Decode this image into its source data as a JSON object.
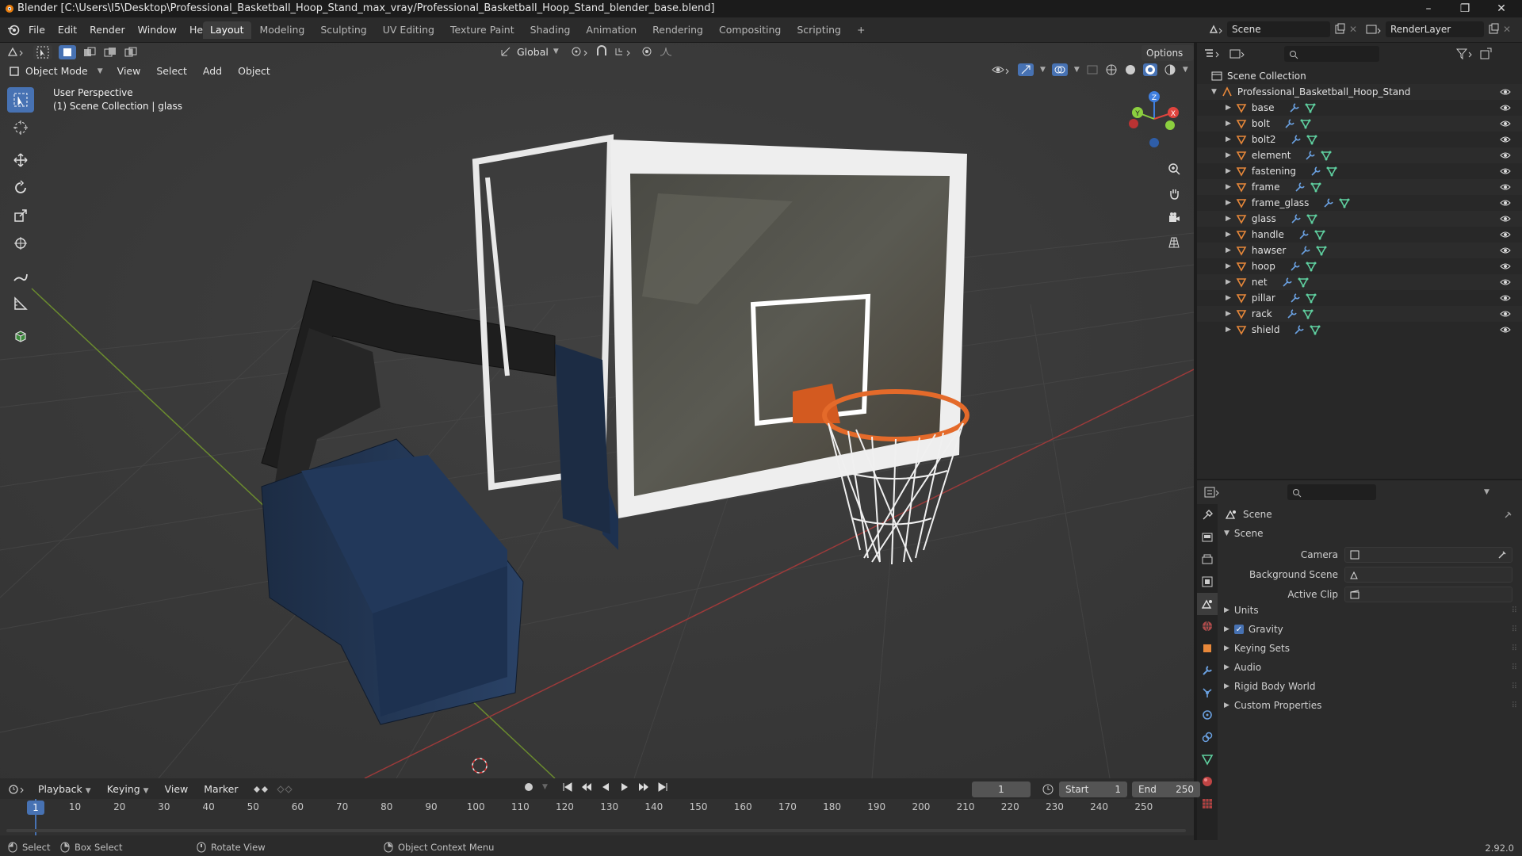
{
  "window": {
    "title": "Blender [C:\\Users\\I5\\Desktop\\Professional_Basketball_Hoop_Stand_max_vray/Professional_Basketball_Hoop_Stand_blender_base.blend]",
    "minimize": "–",
    "maximize": "❐",
    "close": "✕"
  },
  "menubar": {
    "items": [
      "File",
      "Edit",
      "Render",
      "Window",
      "Help"
    ],
    "workspaces": [
      "Layout",
      "Modeling",
      "Sculpting",
      "UV Editing",
      "Texture Paint",
      "Shading",
      "Animation",
      "Rendering",
      "Compositing",
      "Scripting"
    ],
    "active_workspace": "Layout",
    "add_workspace": "+",
    "scene_name": "Scene",
    "view_layer": "RenderLayer"
  },
  "viewport": {
    "transform_orientation": "Global",
    "options_label": "Options",
    "mode": "Object Mode",
    "menus": [
      "View",
      "Select",
      "Add",
      "Object"
    ],
    "overlay_line1": "User Perspective",
    "overlay_line2": "(1) Scene Collection | glass",
    "gizmo": {
      "x": "X",
      "y": "Y",
      "z": "Z"
    }
  },
  "outliner": {
    "root": "Scene Collection",
    "collection": "Professional_Basketball_Hoop_Stand",
    "objects": [
      "base",
      "bolt",
      "bolt2",
      "element",
      "fastening",
      "frame",
      "frame_glass",
      "glass",
      "handle",
      "hawser",
      "hoop",
      "net",
      "pillar",
      "rack",
      "shield"
    ]
  },
  "properties": {
    "context": "Scene",
    "panel": "Scene",
    "fields": [
      {
        "label": "Camera",
        "value": ""
      },
      {
        "label": "Background Scene",
        "value": ""
      },
      {
        "label": "Active Clip",
        "value": ""
      }
    ],
    "subpanels": [
      "Units",
      "Gravity",
      "Keying Sets",
      "Audio",
      "Rigid Body World",
      "Custom Properties"
    ],
    "gravity_checked": true
  },
  "timeline": {
    "menus": [
      "Playback",
      "Keying",
      "View",
      "Marker"
    ],
    "current_frame": "1",
    "start_label": "Start",
    "start": "1",
    "end_label": "End",
    "end": "250",
    "ticks": [
      "10",
      "20",
      "30",
      "40",
      "50",
      "60",
      "70",
      "80",
      "90",
      "100",
      "110",
      "120",
      "130",
      "140",
      "150",
      "160",
      "170",
      "180",
      "190",
      "200",
      "210",
      "220",
      "230",
      "240",
      "250"
    ],
    "playhead": "1"
  },
  "statusbar": {
    "select": "Select",
    "box_select": "Box Select",
    "rotate_view": "Rotate View",
    "context_menu": "Object Context Menu",
    "version": "2.92.0"
  },
  "colors": {
    "accent": "#4772b3",
    "object_orange": "#e8883a",
    "modifier_blue": "#6aa0e0",
    "mesh_green": "#5fd0a0",
    "x_axis": "#e0443e",
    "y_axis": "#8ccf3f",
    "z_axis": "#3f7fe0"
  }
}
